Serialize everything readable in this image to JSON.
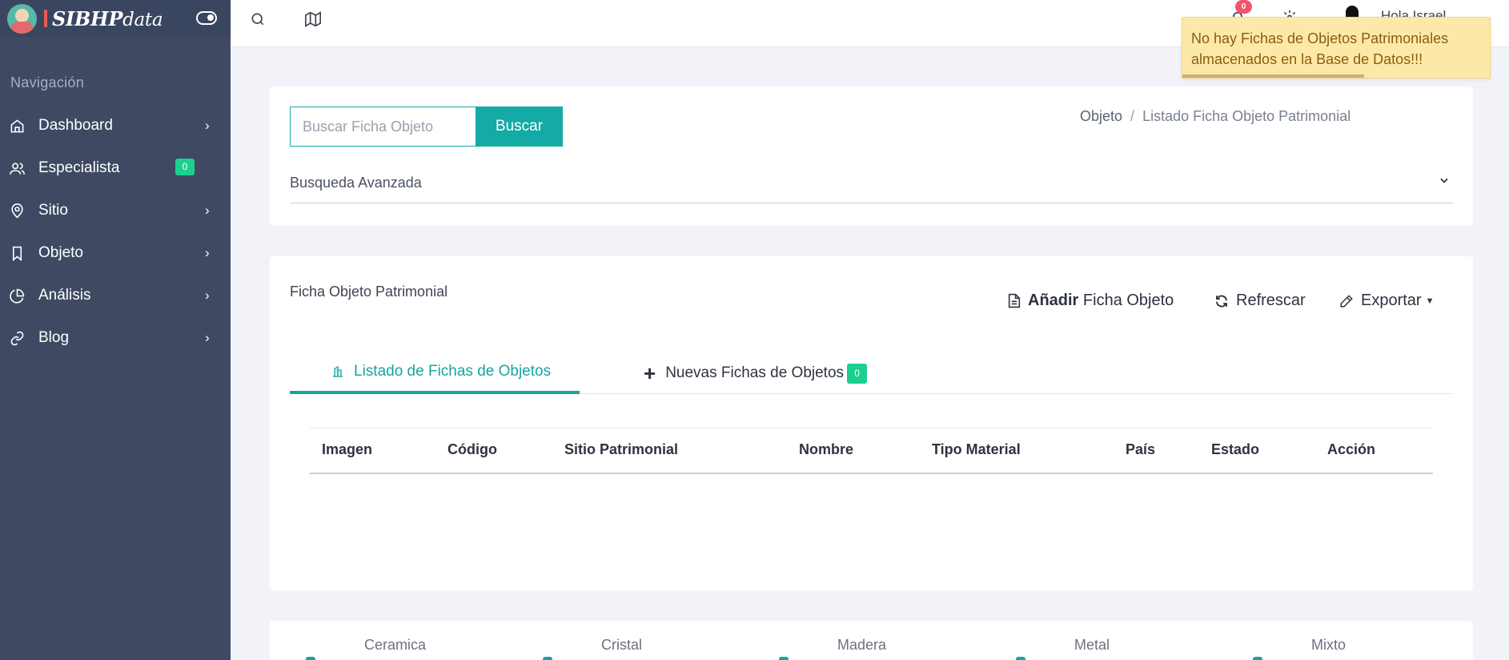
{
  "sidebar": {
    "brand": {
      "name": "SIBHP",
      "sub": "data"
    },
    "heading": "Navigación",
    "items": [
      {
        "label": "Dashboard",
        "icon": "home-icon",
        "chevron": true
      },
      {
        "label": "Especialista",
        "icon": "users-icon",
        "badge": "0"
      },
      {
        "label": "Sitio",
        "icon": "map-pin-icon",
        "chevron": true
      },
      {
        "label": "Objeto",
        "icon": "bookmark-icon",
        "chevron": true
      },
      {
        "label": "Análisis",
        "icon": "pie-chart-icon",
        "chevron": true
      },
      {
        "label": "Blog",
        "icon": "link-icon",
        "chevron": true
      }
    ]
  },
  "topbar": {
    "notifications_count": "0",
    "greeting": "Hola Israel"
  },
  "toast": {
    "message": "No hay Fichas de Objetos Patrimoniales almacenados en la Base de Datos!!!",
    "progress": 0.59
  },
  "search": {
    "placeholder": "Buscar Ficha Objeto",
    "value": "",
    "button": "Buscar"
  },
  "breadcrumb": {
    "parent": "Objeto",
    "separator": "/",
    "current": "Listado Ficha Objeto Patrimonial"
  },
  "advanced_search": {
    "label": "Busqueda Avanzada"
  },
  "list_card": {
    "title": "Ficha Objeto Patrimonial",
    "add_bold": "Añadir",
    "add_rest": "Ficha Objeto",
    "refresh": "Refrescar",
    "export": "Exportar",
    "tabs": [
      {
        "label": "Listado de Fichas de Objetos",
        "active": true
      },
      {
        "label": "Nuevas Fichas de Objetos",
        "badge": "0",
        "active": false
      }
    ],
    "columns": [
      "Imagen",
      "Código",
      "Sitio Patrimonial",
      "Nombre",
      "Tipo Material",
      "País",
      "Estado",
      "Acción"
    ]
  },
  "materials": [
    "Ceramica",
    "Cristal",
    "Madera",
    "Metal",
    "Mixto"
  ],
  "colors": {
    "sidebar": "#3f4a62",
    "accent": "#14aaa5",
    "badge": "#1ccf8e",
    "toast": "#fde9a7"
  }
}
